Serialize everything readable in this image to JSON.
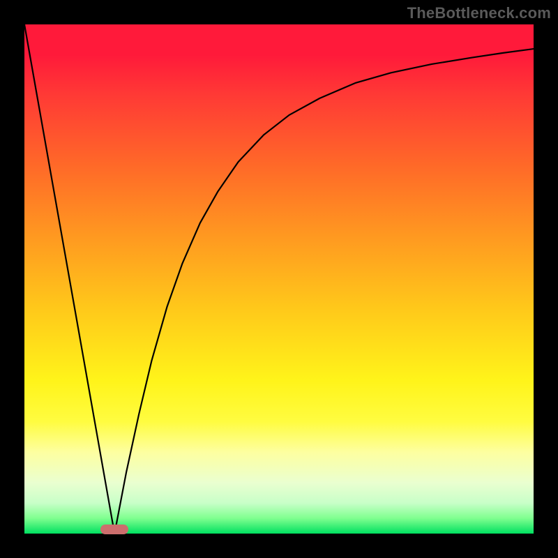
{
  "watermark": "TheBottleneck.com",
  "chart_data": {
    "type": "line",
    "title": "",
    "xlabel": "",
    "ylabel": "",
    "xlim": [
      0,
      1
    ],
    "ylim": [
      0,
      1
    ],
    "grid": false,
    "legend": false,
    "annotations": [
      {
        "type": "marker",
        "x": 0.177,
        "y": 0.0,
        "shape": "rounded-rect",
        "color": "#cc6e6d"
      }
    ],
    "series": [
      {
        "name": "left-branch",
        "x": [
          0.0,
          0.02,
          0.04,
          0.06,
          0.08,
          0.1,
          0.12,
          0.14,
          0.16,
          0.177
        ],
        "y": [
          1.0,
          0.887,
          0.774,
          0.661,
          0.548,
          0.435,
          0.322,
          0.209,
          0.096,
          0.0
        ]
      },
      {
        "name": "right-branch",
        "x": [
          0.177,
          0.2,
          0.225,
          0.25,
          0.28,
          0.31,
          0.345,
          0.38,
          0.42,
          0.47,
          0.52,
          0.58,
          0.65,
          0.72,
          0.8,
          0.88,
          0.94,
          1.0
        ],
        "y": [
          0.0,
          0.12,
          0.235,
          0.34,
          0.445,
          0.53,
          0.61,
          0.672,
          0.73,
          0.783,
          0.822,
          0.855,
          0.885,
          0.905,
          0.922,
          0.935,
          0.944,
          0.952
        ]
      }
    ],
    "gradient_colors": {
      "top": "#ff1a3a",
      "mid": "#fff41a",
      "bottom": "#00e060"
    },
    "marker_color": "#cc6e6d"
  }
}
